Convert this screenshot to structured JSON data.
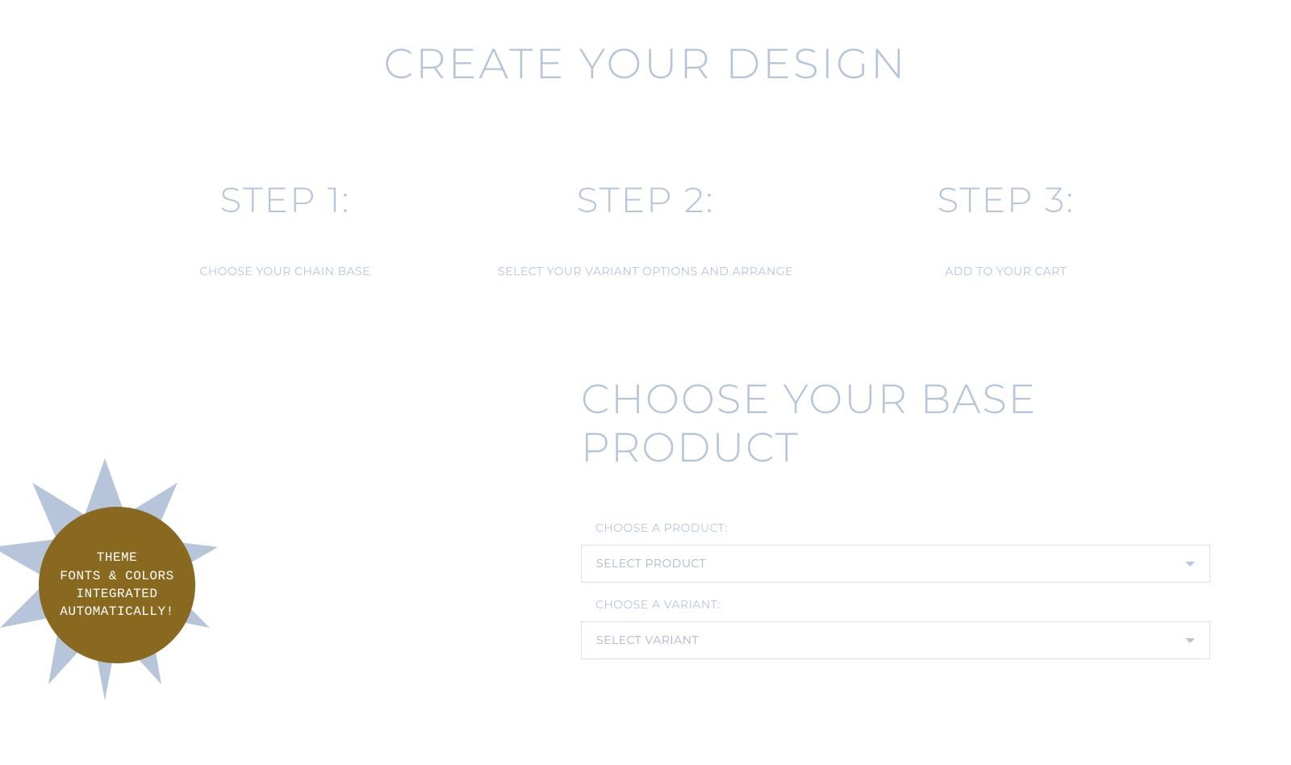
{
  "pageTitle": "CREATE YOUR DESIGN",
  "steps": [
    {
      "title": "STEP 1:",
      "subtitle": "CHOOSE YOUR CHAIN BASE"
    },
    {
      "title": "STEP 2:",
      "subtitle": "SELECT YOUR VARIANT OPTIONS AND ARRANGE"
    },
    {
      "title": "STEP 3:",
      "subtitle": "ADD TO YOUR CART"
    }
  ],
  "baseSection": {
    "title": "CHOOSE YOUR BASE PRODUCT",
    "productLabel": "CHOOSE A PRODUCT:",
    "productPlaceholder": "SELECT PRODUCT",
    "variantLabel": "CHOOSE A VARIANT:",
    "variantPlaceholder": "SELECT VARIANT"
  },
  "badge": {
    "text": "THEME\nFONTS & COLORS\nINTEGRATED\nAUTOMATICALLY!"
  },
  "colors": {
    "text": "#b6c5da",
    "badge": "#89691f",
    "starburst": "#b6c5da"
  }
}
